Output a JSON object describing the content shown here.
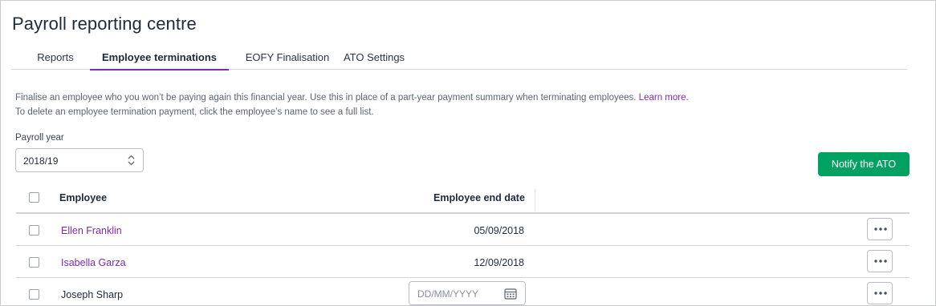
{
  "page": {
    "title": "Payroll reporting centre"
  },
  "tabs": [
    {
      "label": "Reports",
      "active": false
    },
    {
      "label": "Employee terminations",
      "active": true
    },
    {
      "label": "EOFY Finalisation",
      "active": false
    },
    {
      "label": "ATO Settings",
      "active": false
    }
  ],
  "description": {
    "line1": "Finalise an employee who you won’t be paying again this financial year. Use this in place of a part-year payment summary when terminating employees.",
    "learn_more": "Learn more.",
    "line2": "To delete an employee termination payment, click the employee’s name to see a full list."
  },
  "payroll_year": {
    "label": "Payroll year",
    "value": "2018/19"
  },
  "notify_button": {
    "label": "Notify the ATO"
  },
  "table": {
    "headers": {
      "employee": "Employee",
      "end_date": "Employee end date"
    },
    "rows": [
      {
        "name": "Ellen Franklin",
        "end_date": "05/09/2018",
        "is_link": true
      },
      {
        "name": "Isabella Garza",
        "end_date": "12/09/2018",
        "is_link": true
      },
      {
        "name": "Joseph Sharp",
        "end_date": "",
        "is_link": false,
        "date_placeholder": "DD/MM/YYYY"
      }
    ]
  },
  "icons": {
    "select_arrows": "chevron-up-down-icon",
    "more": "ellipsis-icon",
    "calendar": "calendar-icon"
  },
  "colors": {
    "accent": "#7e2ba7",
    "primary_button": "#00a161",
    "text": "#1e2a3a"
  }
}
